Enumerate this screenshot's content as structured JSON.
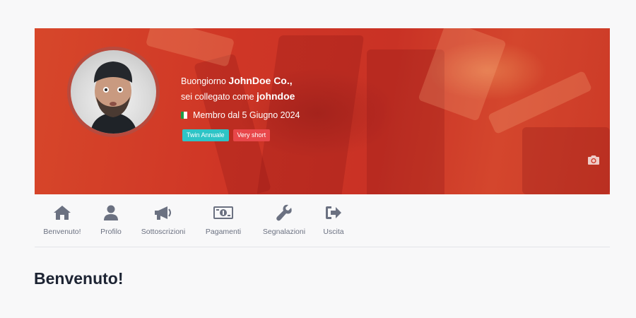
{
  "profile": {
    "greeting_prefix": "Buongiorno ",
    "company_name": "JohnDoe Co.,",
    "logged_as_prefix": "sei collegato come ",
    "username": "johndoe",
    "member_since": "Membro dal 5 Giugno 2024",
    "flag_icon": "italy-flag-icon",
    "badges": [
      {
        "label": "Twin Annuale",
        "color": "#2ec4c6"
      },
      {
        "label": "Very short",
        "color": "#e8474a"
      }
    ],
    "camera_icon": "camera-icon"
  },
  "nav": {
    "items": [
      {
        "label": "Benvenuto!",
        "icon": "home-icon"
      },
      {
        "label": "Profilo",
        "icon": "user-icon"
      },
      {
        "label": "Sottoscrizioni",
        "icon": "megaphone-icon"
      },
      {
        "label": "Pagamenti",
        "icon": "money-icon"
      },
      {
        "label": "Segnalazioni",
        "icon": "wrench-icon"
      },
      {
        "label": "Uscita",
        "icon": "sign-out-icon"
      }
    ]
  },
  "main": {
    "title": "Benvenuto!"
  },
  "colors": {
    "cover": "#cf3626",
    "icon": "#6b7181",
    "heading": "#1d2433"
  }
}
